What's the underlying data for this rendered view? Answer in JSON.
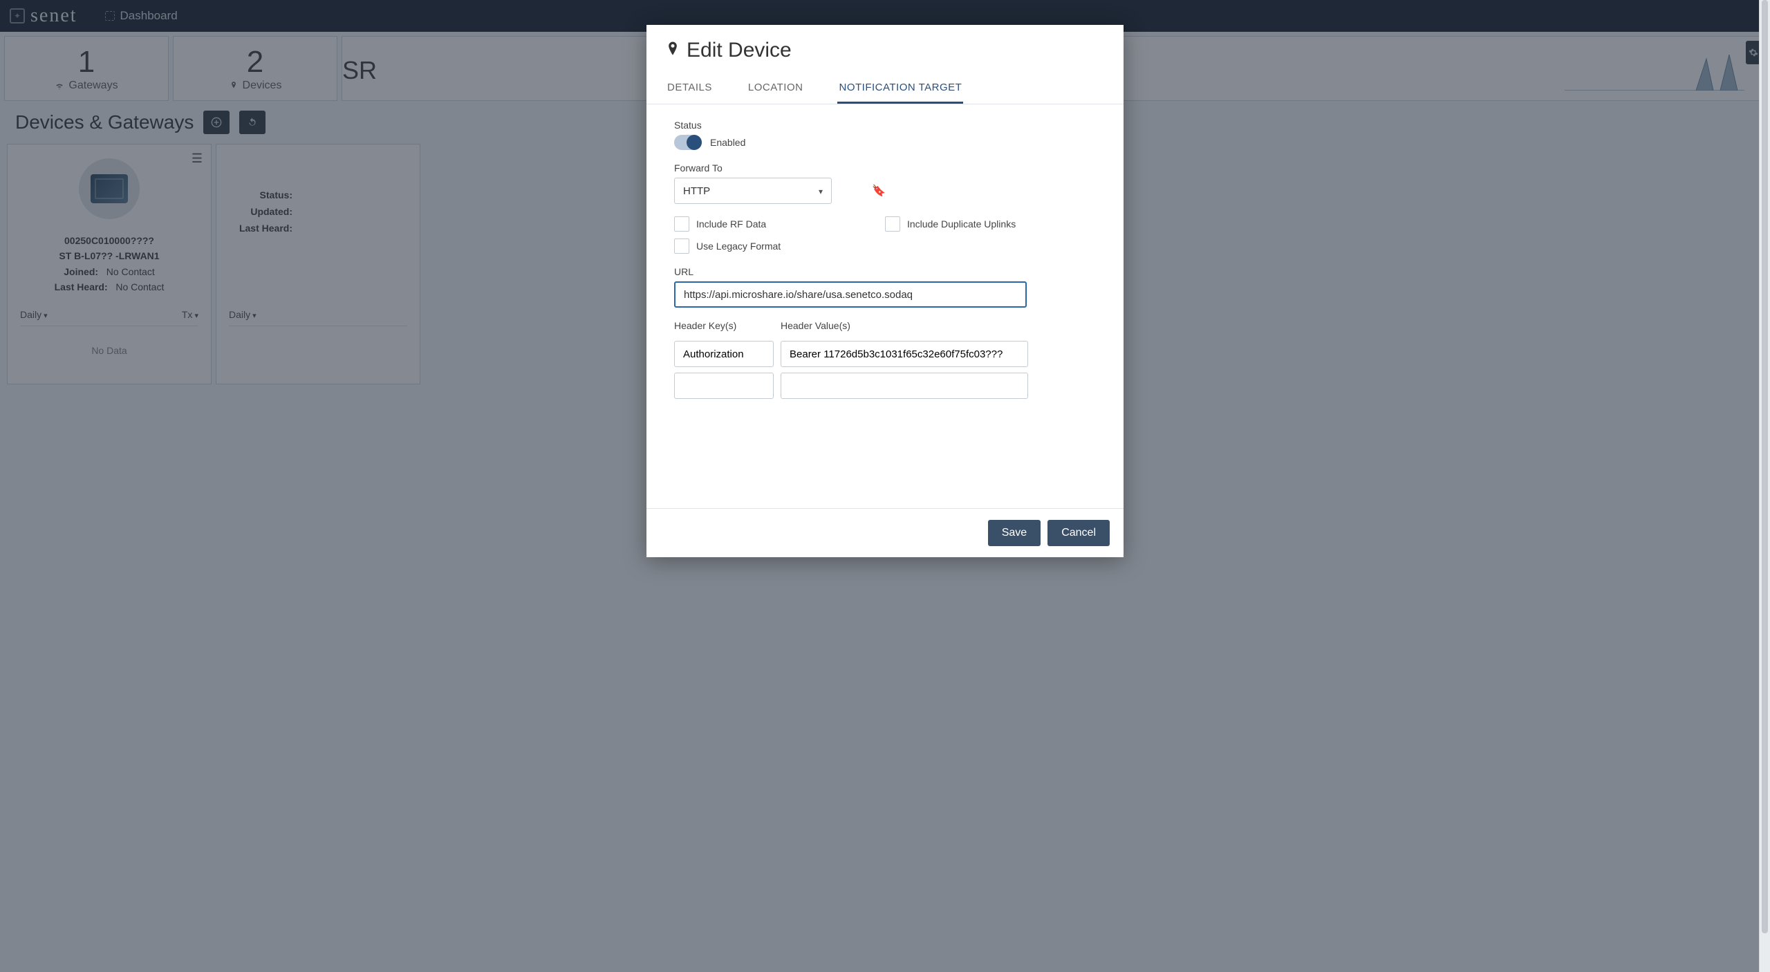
{
  "navbar": {
    "brand": "senet",
    "dash_label": "Dashboard"
  },
  "summary": {
    "gateways_count": "1",
    "gateways_label": "Gateways",
    "devices_count": "2",
    "devices_label": "Devices",
    "sr_label": "SR"
  },
  "section": {
    "title": "Devices & Gateways"
  },
  "cards": {
    "c1": {
      "id": "00250C010000????",
      "name": "ST B-L07?? -LRWAN1",
      "joined_lbl": "Joined:",
      "joined_val": "No Contact",
      "heard_lbl": "Last Heard:",
      "heard_val": "No Contact",
      "daily": "Daily",
      "tx": "Tx",
      "nodata": "No Data"
    },
    "c2": {
      "status_lbl": "Status:",
      "updated_lbl": "Updated:",
      "heard_lbl": "Last Heard:",
      "daily": "Daily"
    }
  },
  "modal": {
    "title": "Edit Device",
    "tabs": {
      "details": "DETAILS",
      "location": "LOCATION",
      "notif": "NOTIFICATION TARGET"
    },
    "status_label": "Status",
    "status_value": "Enabled",
    "forward_label": "Forward To",
    "forward_value": "HTTP",
    "chk_rf": "Include RF Data",
    "chk_dup": "Include Duplicate Uplinks",
    "chk_legacy": "Use Legacy Format",
    "url_label": "URL",
    "url_value": "https://api.microshare.io/share/usa.senetco.sodaq",
    "hkeys_label": "Header Key(s)",
    "hvals_label": "Header Value(s)",
    "hkey1": "Authorization",
    "hval1": "Bearer 11726d5b3c1031f65c32e60f75fc03???",
    "save": "Save",
    "cancel": "Cancel"
  }
}
